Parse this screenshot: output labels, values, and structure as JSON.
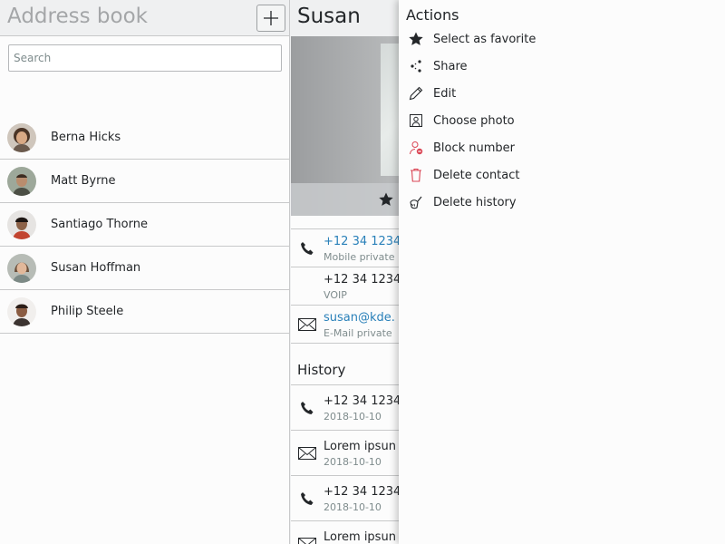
{
  "left": {
    "title": "Address book",
    "add_button": "+",
    "search_placeholder": "Search",
    "contacts": [
      {
        "name": "Berna Hicks"
      },
      {
        "name": "Matt Byrne"
      },
      {
        "name": "Santiago Thorne"
      },
      {
        "name": "Susan Hoffman"
      },
      {
        "name": "Philip Steele"
      }
    ]
  },
  "detail": {
    "title": "Susan",
    "fields": [
      {
        "value": "+12 34 1234",
        "label": "Mobile private",
        "icon": "phone-icon",
        "link": true
      },
      {
        "value": "+12 34 1234",
        "label": "VOIP",
        "icon": "",
        "link": false
      },
      {
        "value": "susan@kde.",
        "label": "E-Mail private",
        "icon": "mail-icon",
        "link": true
      }
    ],
    "history_heading": "History",
    "history": [
      {
        "value": "+12 34 1234",
        "date": "2018-10-10",
        "icon": "phone-icon"
      },
      {
        "value": "Lorem ipsun",
        "date": "2018-10-10",
        "icon": "mail-icon"
      },
      {
        "value": "+12 34 1234",
        "date": "2018-10-10",
        "icon": "phone-icon"
      },
      {
        "value": "Lorem ipsun",
        "date": "",
        "icon": "mail-icon"
      }
    ]
  },
  "drawer": {
    "title": "Actions",
    "actions": [
      {
        "label": "Select as favorite",
        "icon": "star-icon"
      },
      {
        "label": "Share",
        "icon": "share-icon"
      },
      {
        "label": "Edit",
        "icon": "pencil-icon"
      },
      {
        "label": "Choose photo",
        "icon": "photo-icon"
      },
      {
        "label": "Block number",
        "icon": "block-user-icon"
      },
      {
        "label": "Delete contact",
        "icon": "trash-icon"
      },
      {
        "label": "Delete history",
        "icon": "clear-history-icon"
      }
    ]
  },
  "colors": {
    "link": "#2980b9",
    "danger": "#da4453",
    "text": "#232629",
    "muted": "#7f8c8d"
  }
}
